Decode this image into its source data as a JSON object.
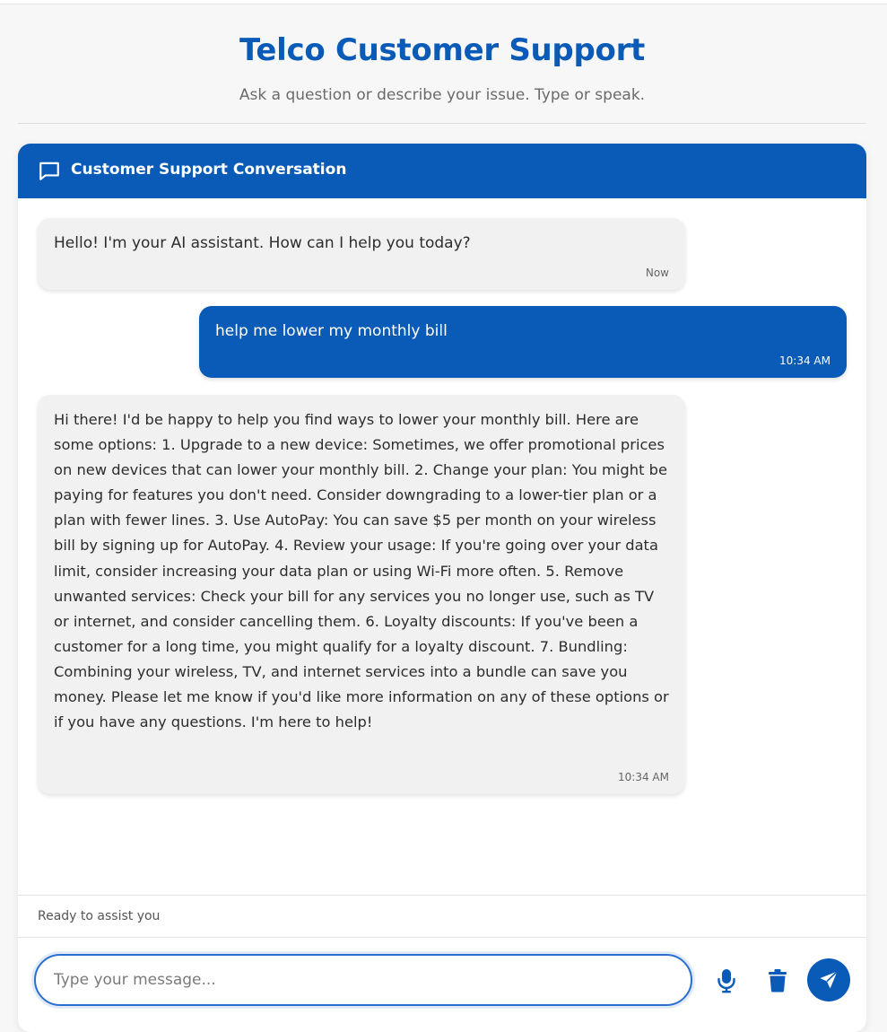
{
  "header": {
    "title": "Telco Customer Support",
    "subtitle": "Ask a question or describe your issue. Type or speak."
  },
  "conversation": {
    "title": "Customer Support Conversation",
    "icon": "chat-bubble-icon",
    "messages": [
      {
        "sender": "bot",
        "text": "Hello! I'm your AI assistant. How can I help you today?",
        "time": "Now"
      },
      {
        "sender": "user",
        "text": "help me lower my monthly bill",
        "time": "10:34 AM"
      },
      {
        "sender": "bot",
        "text": "Hi there! I'd be happy to help you find ways to lower your monthly bill. Here are some options: 1. Upgrade to a new device: Sometimes, we offer promotional prices on new devices that can lower your monthly bill. 2. Change your plan: You might be paying for features you don't need. Consider downgrading to a lower-tier plan or a plan with fewer lines. 3. Use AutoPay: You can save $5 per month on your wireless bill by signing up for AutoPay. 4. Review your usage: If you're going over your data limit, consider increasing your data plan or using Wi-Fi more often. 5. Remove unwanted services: Check your bill for any services you no longer use, such as TV or internet, and consider cancelling them. 6. Loyalty discounts: If you've been a customer for a long time, you might qualify for a loyalty discount. 7. Bundling: Combining your wireless, TV, and internet services into a bundle can save you money. Please let me know if you'd like more information on any of these options or if you have any questions. I'm here to help!",
        "time": "10:34 AM"
      }
    ]
  },
  "status": "Ready to assist you",
  "composer": {
    "placeholder": "Type your message...",
    "value": "",
    "mic_icon": "microphone-icon",
    "clear_icon": "trash-icon",
    "send_icon": "send-icon"
  },
  "colors": {
    "brand": "#0a5bb8",
    "bot_bubble": "#f1f1f1",
    "background": "#f7f7f7"
  }
}
